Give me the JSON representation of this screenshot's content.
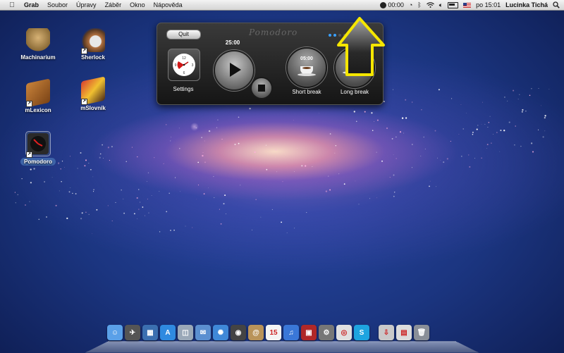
{
  "menubar": {
    "app_name": "Grab",
    "menus": [
      "Soubor",
      "Úpravy",
      "Záběr",
      "Okno",
      "Nápověda"
    ],
    "timer": "00:00",
    "clock": "po 15:01",
    "user": "Lucinka Tichá"
  },
  "desktop": {
    "icons": [
      {
        "label": "Machinarium",
        "icon": "machinarium-icon"
      },
      {
        "label": "Sherlock",
        "icon": "sherlock-icon"
      },
      {
        "label": "mLexicon",
        "icon": "mlexicon-icon"
      },
      {
        "label": "mSlovník",
        "icon": "mslovnik-icon"
      },
      {
        "label": "Pomodoro",
        "icon": "pomodoro-icon",
        "selected": true
      }
    ]
  },
  "pomodoro": {
    "title": "Pomodoro",
    "quit_label": "Quit",
    "main_time": "25:00",
    "settings_label": "Settings",
    "short_break_time": "05:00",
    "short_break_label": "Short break",
    "long_break_label": "Long break",
    "clock_numbers": [
      "12",
      "3",
      "6",
      "9"
    ]
  },
  "dock": {
    "items": [
      {
        "name": "finder",
        "color": "#5aa0e8",
        "glyph": "☺"
      },
      {
        "name": "launchpad",
        "color": "#555",
        "glyph": "✈"
      },
      {
        "name": "mission-control",
        "color": "#3b6fb0",
        "glyph": "▦"
      },
      {
        "name": "app-store",
        "color": "#2f8ae0",
        "glyph": "A"
      },
      {
        "name": "preview",
        "color": "#9aa8b8",
        "glyph": "◫"
      },
      {
        "name": "mail",
        "color": "#5b8fd0",
        "glyph": "✉"
      },
      {
        "name": "safari",
        "color": "#3f88d8",
        "glyph": "✺"
      },
      {
        "name": "facetime",
        "color": "#444",
        "glyph": "◉"
      },
      {
        "name": "address-book",
        "color": "#b9935a",
        "glyph": "@"
      },
      {
        "name": "calendar",
        "color": "#f4f4f4",
        "glyph": "15"
      },
      {
        "name": "itunes",
        "color": "#3a77d8",
        "glyph": "♫"
      },
      {
        "name": "photo-booth",
        "color": "#b02828",
        "glyph": "▣"
      },
      {
        "name": "system-preferences",
        "color": "#777",
        "glyph": "⚙"
      },
      {
        "name": "chrome",
        "color": "#e0e0e0",
        "glyph": "◎"
      },
      {
        "name": "skype",
        "color": "#1ea4e0",
        "glyph": "S"
      },
      {
        "name": "downloads",
        "color": "#c9c9c9",
        "glyph": "⇩"
      },
      {
        "name": "documents",
        "color": "#dcdcdc",
        "glyph": "▤"
      },
      {
        "name": "trash",
        "color": "#8a8f98",
        "glyph": "🗑"
      }
    ]
  },
  "colors": {
    "highlight_arrow": "#f5e600",
    "accent_blue": "#3aa0ff"
  }
}
